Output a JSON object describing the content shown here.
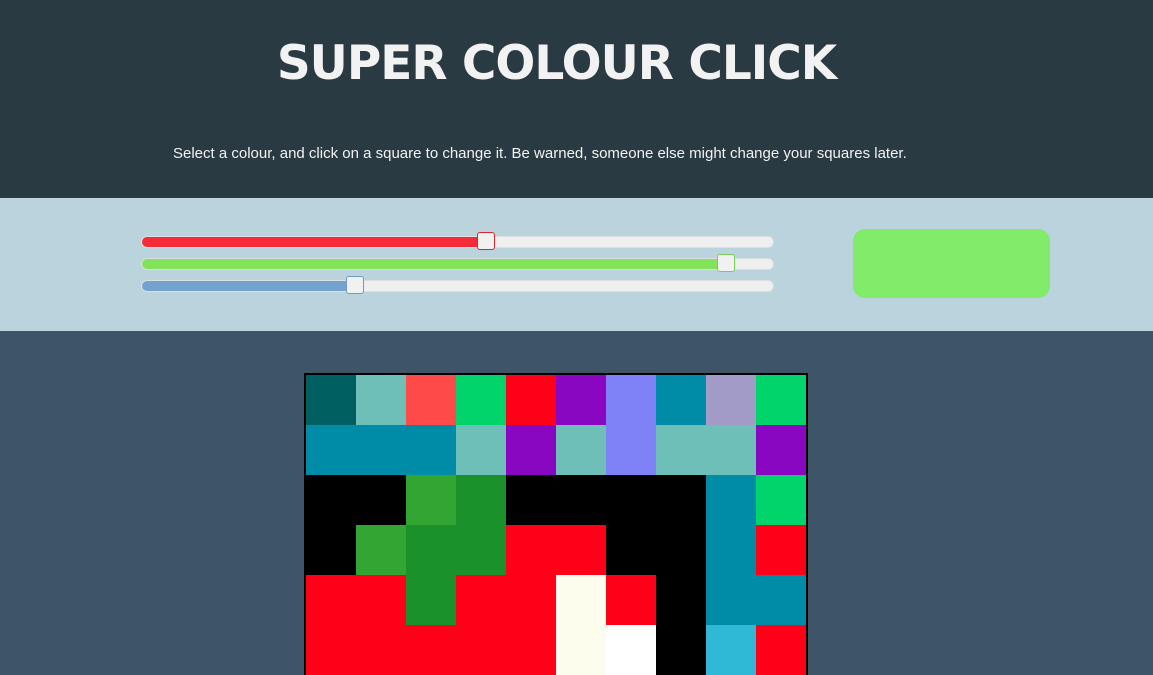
{
  "header": {
    "title": "SUPER COLOUR CLICK",
    "instructions": "Select a colour, and click on a square to change it. Be warned, someone else might change your squares later."
  },
  "colors": {
    "header_bg": "#293a42",
    "controls_bg": "#bad3dc",
    "page_bg": "#3d5566"
  },
  "controls": {
    "sliders": [
      {
        "channel": "red",
        "value": 0.545,
        "color": "#f52c37"
      },
      {
        "channel": "green",
        "value": 0.925,
        "color": "#82e35a"
      },
      {
        "channel": "blue",
        "value": 0.338,
        "color": "#73a2cf"
      }
    ],
    "selected_colour": "#82ec6a"
  },
  "board": {
    "columns": 10,
    "visible_rows": 6,
    "cells": [
      [
        "#005f60",
        "#6dbfb7",
        "#ff4a4a",
        "#00d46b",
        "#ff0019",
        "#8a07c1",
        "#7f82f7",
        "#008ba7",
        "#a39bc7",
        "#00d46b"
      ],
      [
        "#008ba7",
        "#008ba7",
        "#008ba7",
        "#6dbfb7",
        "#8a07c1",
        "#6dbfb7",
        "#7f82f7",
        "#6dbfb7",
        "#6dbfb7",
        "#8a07c1"
      ],
      [
        "#000000",
        "#000000",
        "#33a533",
        "#1b912b",
        "#000000",
        "#000000",
        "#000000",
        "#000000",
        "#008ba7",
        "#00d46b"
      ],
      [
        "#000000",
        "#33a533",
        "#1b912b",
        "#1b912b",
        "#ff0019",
        "#ff0019",
        "#000000",
        "#000000",
        "#008ba7",
        "#ff0019"
      ],
      [
        "#ff0019",
        "#ff0019",
        "#1b912b",
        "#ff0019",
        "#ff0019",
        "#fdfdee",
        "#ff0019",
        "#000000",
        "#008ba7",
        "#008ba7"
      ],
      [
        "#ff0019",
        "#ff0019",
        "#ff0019",
        "#ff0019",
        "#ff0019",
        "#fdfdee",
        "#ffffff",
        "#000000",
        "#2fb9d6",
        "#ff0019"
      ]
    ]
  }
}
